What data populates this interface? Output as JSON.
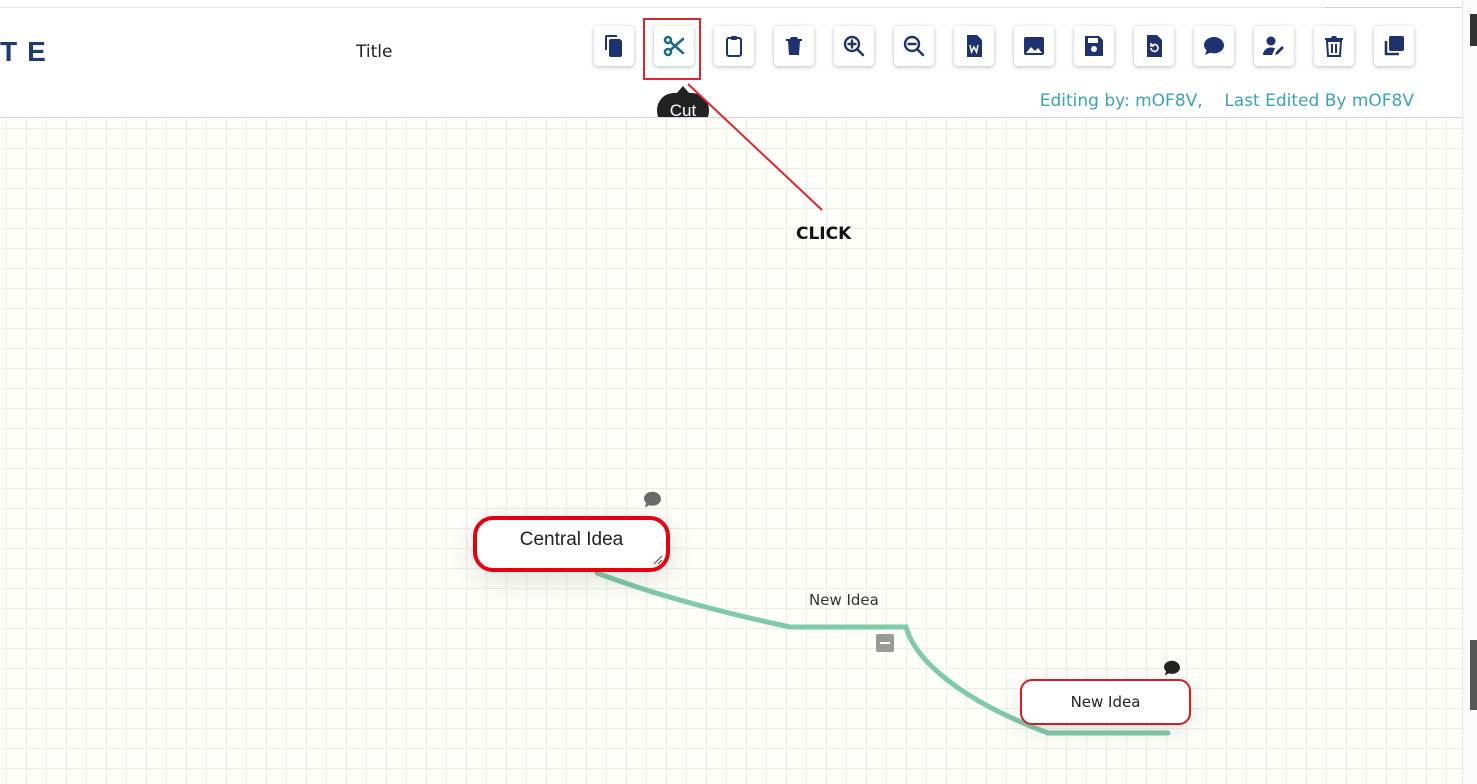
{
  "app": {
    "logo_text": "TE",
    "title": "Title"
  },
  "toolbar": {
    "buttons": [
      {
        "name": "copy",
        "icon": "copy-icon"
      },
      {
        "name": "cut",
        "icon": "scissors-icon",
        "highlighted": true
      },
      {
        "name": "paste",
        "icon": "clipboard-icon"
      },
      {
        "name": "delete",
        "icon": "trash-icon"
      },
      {
        "name": "zoom-in",
        "icon": "zoom-in-icon"
      },
      {
        "name": "zoom-out",
        "icon": "zoom-out-icon"
      },
      {
        "name": "export-word",
        "icon": "word-file-icon"
      },
      {
        "name": "export-image",
        "icon": "image-icon"
      },
      {
        "name": "save",
        "icon": "save-icon"
      },
      {
        "name": "restore",
        "icon": "restore-file-icon"
      },
      {
        "name": "comment",
        "icon": "comment-icon"
      },
      {
        "name": "edit-user",
        "icon": "user-edit-icon"
      },
      {
        "name": "clear",
        "icon": "trash-can-icon"
      },
      {
        "name": "duplicate",
        "icon": "clone-icon"
      }
    ],
    "tooltip": "Cut"
  },
  "status": {
    "editing_by": "Editing by: mOF8V,",
    "last_edited_by": "Last Edited By mOF8V"
  },
  "annotation": {
    "callout_text": "CLICK",
    "color": "#e0242c"
  },
  "mindmap": {
    "central_node": {
      "label": "Central Idea"
    },
    "edge_label": "New Idea",
    "child_node": {
      "label": "New Idea"
    },
    "edge_color": "#7fcaa8"
  },
  "colors": {
    "icon": "#1f3270",
    "icon_active": "#1a6e80",
    "status_text": "#3ba3b8",
    "node_border": "#e8000d"
  }
}
